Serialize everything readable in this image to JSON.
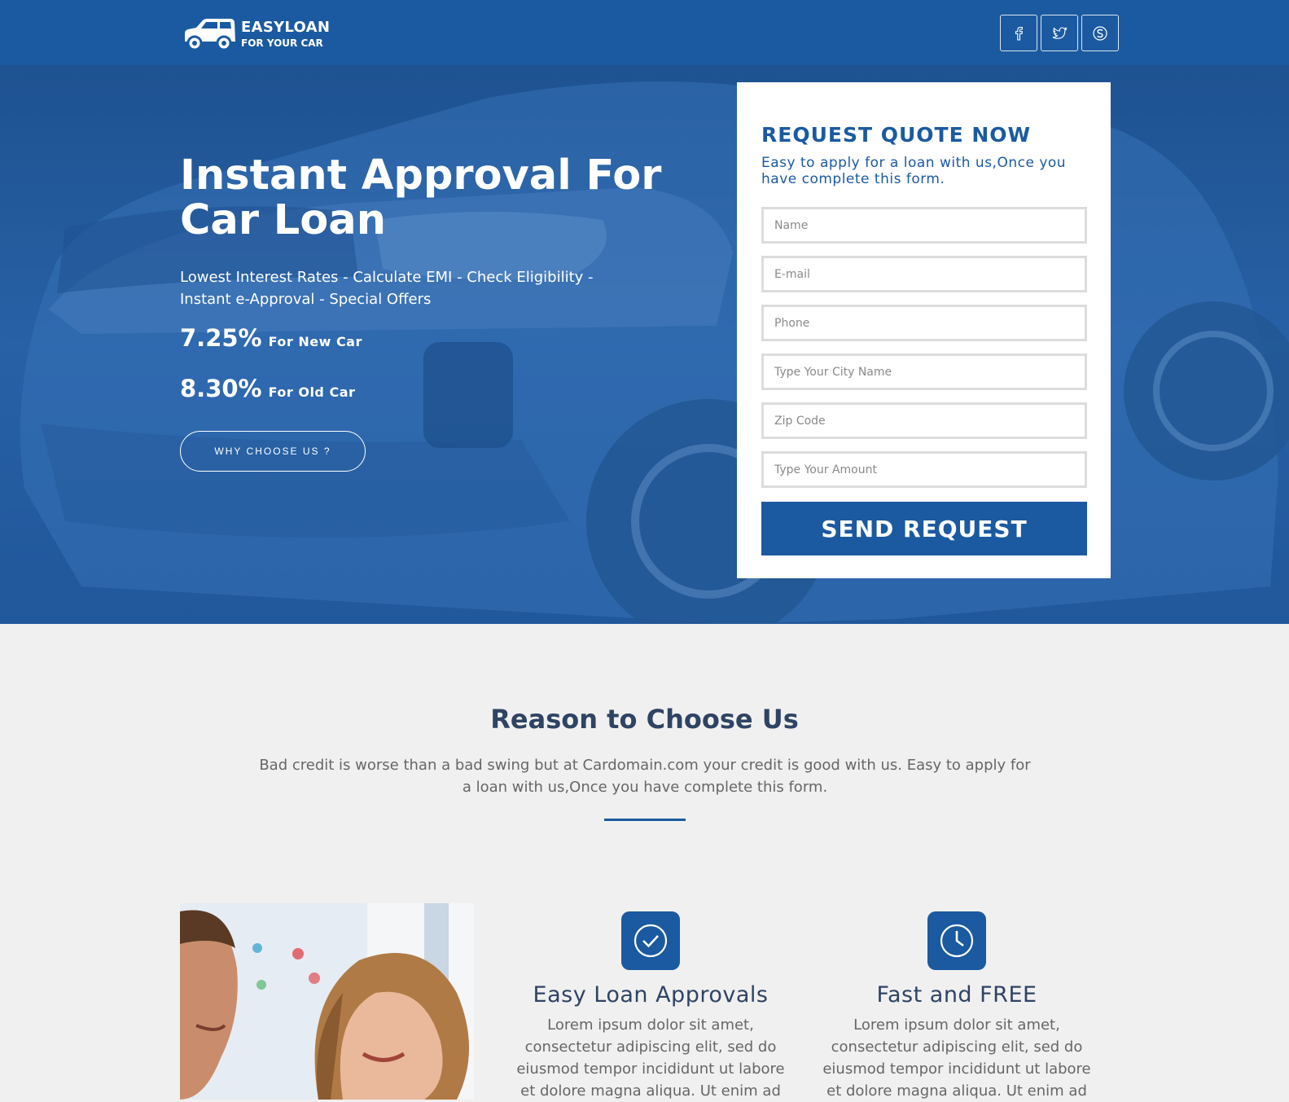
{
  "brand": {
    "name": "EASYLOAN",
    "tagline": "FOR YOUR CAR"
  },
  "social": [
    {
      "icon": "facebook-icon"
    },
    {
      "icon": "twitter-icon"
    },
    {
      "icon": "skype-icon"
    }
  ],
  "hero": {
    "title": "Instant Approval For Car Loan",
    "subtitle": "Lowest Interest Rates - Calculate EMI - Check Eligibility - Instant e-Approval - Special Offers",
    "rates": [
      {
        "value": "7.25%",
        "label": "For New Car"
      },
      {
        "value": "8.30%",
        "label": "For Old Car"
      }
    ],
    "cta": "WHY CHOOSE US ?"
  },
  "form": {
    "title": "REQUEST QUOTE NOW",
    "subtitle": "Easy to apply for a loan with us,Once you have complete this form.",
    "fields": {
      "name": "Name",
      "email": "E-mail",
      "phone": "Phone",
      "city": "Type Your City Name",
      "zip": "Zip Code",
      "amount": "Type Your Amount"
    },
    "submit": "SEND REQUEST"
  },
  "reason": {
    "title": "Reason to Choose Us",
    "description": "Bad credit is worse than a bad swing but at Cardomain.com your credit is good with us. Easy to apply for a loan with us,Once you have complete this form."
  },
  "features": [
    {
      "icon": "checkmark-icon",
      "title": "Easy Loan Approvals",
      "text": "Lorem ipsum dolor sit amet, consectetur adipiscing elit, sed do eiusmod tempor incididunt ut labore et dolore magna aliqua. Ut enim ad"
    },
    {
      "icon": "clock-icon",
      "title": "Fast and FREE",
      "text": "Lorem ipsum dolor sit amet, consectetur adipiscing elit, sed do eiusmod tempor incididunt ut labore et dolore magna aliqua. Ut enim ad"
    }
  ],
  "colors": {
    "primary": "#1b5aa0",
    "heading": "#2f4363",
    "background": "#f0f0f0"
  }
}
